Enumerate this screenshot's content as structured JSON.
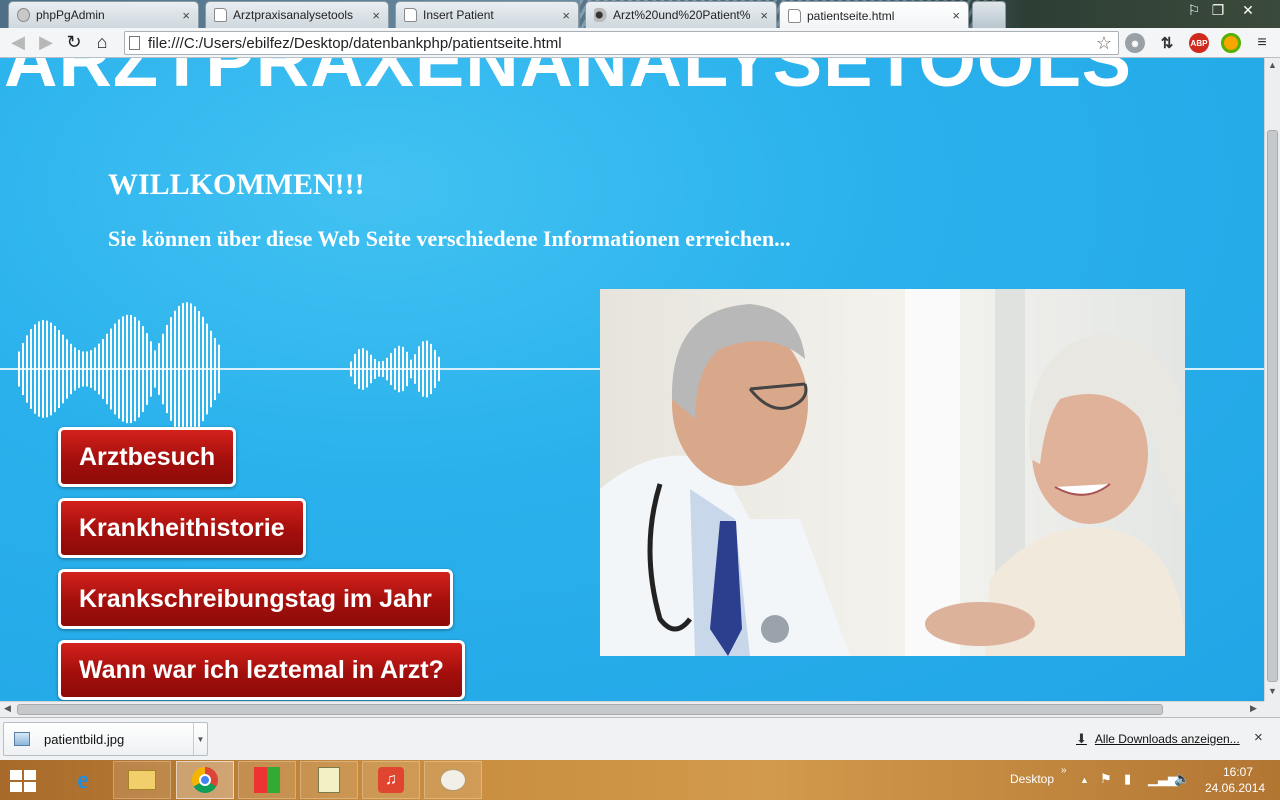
{
  "browser": {
    "tabs": [
      {
        "label": "phpPgAdmin",
        "active": false
      },
      {
        "label": "Arztpraxisanalysetools",
        "active": false
      },
      {
        "label": "Insert Patient",
        "active": false
      },
      {
        "label": "Arzt%20und%20Patient%",
        "active": false
      },
      {
        "label": "patientseite.html",
        "active": true
      }
    ],
    "tab_close_glyph": "×",
    "url": "file:///C:/Users/ebilfez/Desktop/datenbankphp/patientseite.html",
    "extensions": {
      "abp_label": "ABP"
    }
  },
  "page": {
    "site_title": "ARZTPRAXENANALYSETOOLS",
    "welcome": "WILLKOMMEN!!!",
    "subtitle": "Sie können über diese Web Seite verschiedene Informationen erreichen...",
    "buttons": {
      "arztbesuch": "Arztbesuch",
      "krankheithistorie": "Krankheithistorie",
      "krankschreibungstag": "Krankschreibungstag im Jahr",
      "letzter_besuch": "Wann war ich leztemal in Arzt?"
    },
    "colors": {
      "background": "#2aa6e4",
      "button_red": "#b0120e",
      "button_border": "#ffffff",
      "text": "#ffffff"
    }
  },
  "downloads": {
    "file_name": "patientbild.jpg",
    "show_all": "Alle Downloads anzeigen...",
    "close_glyph": "×"
  },
  "taskbar": {
    "desktop_label": "Desktop",
    "time": "16:07",
    "date": "24.06.2014"
  }
}
